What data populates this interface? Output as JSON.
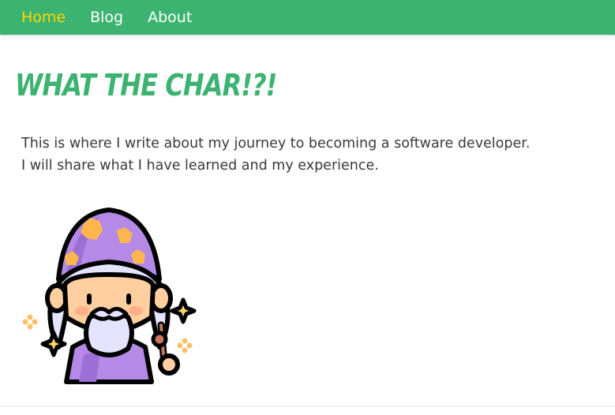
{
  "nav": {
    "items": [
      {
        "label": "Home",
        "active": true
      },
      {
        "label": "Blog",
        "active": false
      },
      {
        "label": "About",
        "active": false
      }
    ],
    "background": "#3cb371",
    "active_color": "#ffd700"
  },
  "hero": {
    "title": "WHAT THE CHAR!?!",
    "title_color": "#3cb371",
    "intro_lines": [
      "This is where I write about my journey to becoming a software developer.",
      "I will share what I have learned and my experience."
    ]
  },
  "illustration": {
    "icon": "wizard-icon",
    "colors": {
      "hat": "#b48ae6",
      "hat_shade": "#9b6fd6",
      "stars": "#ffb74d",
      "skin": "#ffcfa0",
      "beard": "#e4e4ff",
      "outline": "#000000"
    }
  }
}
